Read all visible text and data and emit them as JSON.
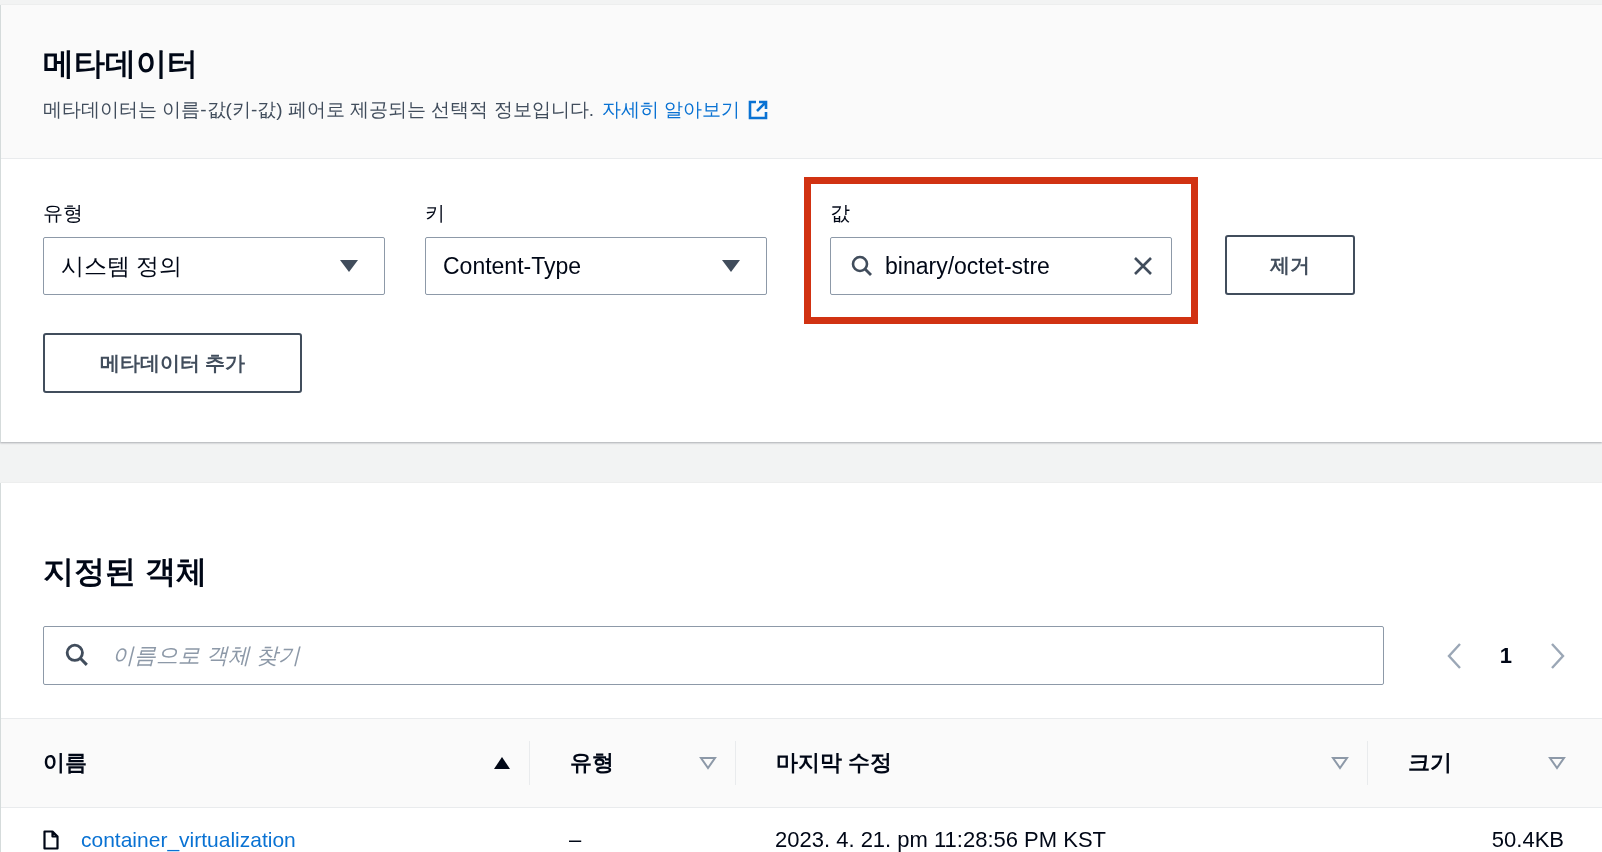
{
  "metadata_panel": {
    "title": "메타데이터",
    "description": "메타데이터는 이름-값(키-값) 페어로 제공되는 선택적 정보입니다.",
    "learn_more_link": "자세히 알아보기",
    "fields": [
      {
        "kind": "select",
        "label": "유형",
        "value": "시스템 정의",
        "highlighted": false
      },
      {
        "kind": "select",
        "label": "키",
        "value": "Content-Type",
        "highlighted": false
      },
      {
        "kind": "search",
        "label": "값",
        "value": "binary/octet-stre",
        "highlighted": true
      }
    ],
    "remove_button": "제거",
    "add_button": "메타데이터 추가"
  },
  "objects_panel": {
    "title": "지정된 객체",
    "search": {
      "placeholder": "이름으로 객체 찾기"
    },
    "pagination": {
      "page": "1"
    },
    "table": {
      "columns": [
        {
          "label": "이름",
          "sorted": true
        },
        {
          "label": "유형",
          "sorted": false
        },
        {
          "label": "마지막 수정",
          "sorted": false
        },
        {
          "label": "크기",
          "sorted": false
        }
      ],
      "rows": [
        {
          "name": "container_virtualization",
          "type": "–",
          "last_modified": "2023. 4. 21. pm 11:28:56 PM KST",
          "size": "50.4KB"
        }
      ]
    }
  }
}
